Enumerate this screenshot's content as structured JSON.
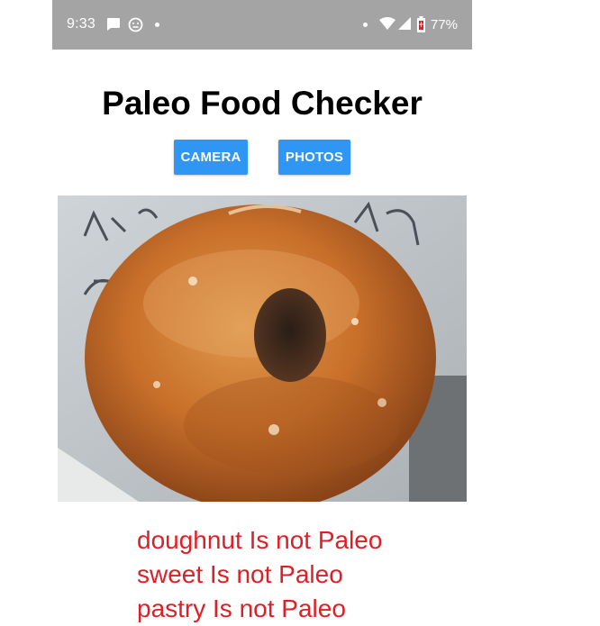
{
  "status_bar": {
    "time": "9:33",
    "battery": "77%",
    "icons": [
      "chat-icon",
      "face-icon",
      "wifi-icon",
      "signal-icon",
      "battery-icon"
    ]
  },
  "app": {
    "title": "Paleo Food Checker",
    "buttons": {
      "camera": "CAMERA",
      "photos": "PHOTOS"
    },
    "results": [
      "doughnut Is not Paleo",
      "sweet Is not Paleo",
      "pastry Is not Paleo"
    ]
  },
  "image": {
    "subject": "glazed doughnut photo"
  },
  "colors": {
    "status_bar": "#a4a4a4",
    "button": "#2f96f3",
    "result_text": "#e01e26"
  }
}
